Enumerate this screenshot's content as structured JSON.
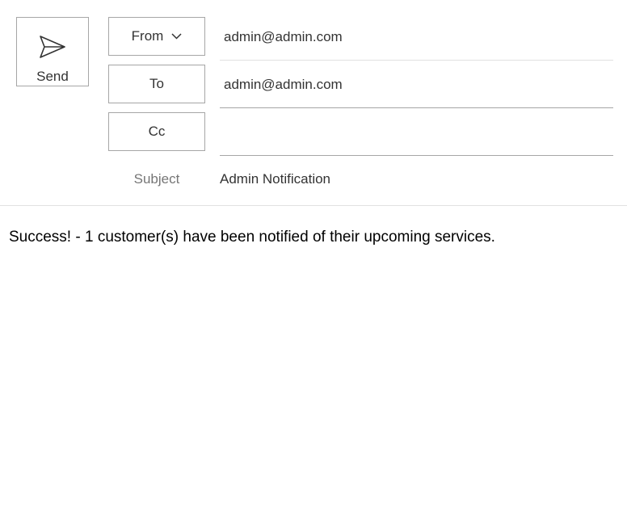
{
  "toolbar": {
    "send_label": "Send",
    "send_icon": "send-icon"
  },
  "header": {
    "from_label": "From",
    "from_value": "admin@admin.com",
    "to_label": "To",
    "to_value": "admin@admin.com",
    "cc_label": "Cc",
    "cc_value": "",
    "subject_label": "Subject",
    "subject_value": "Admin Notification"
  },
  "body": {
    "message": "Success! - 1 customer(s) have been notified of their upcoming services."
  }
}
